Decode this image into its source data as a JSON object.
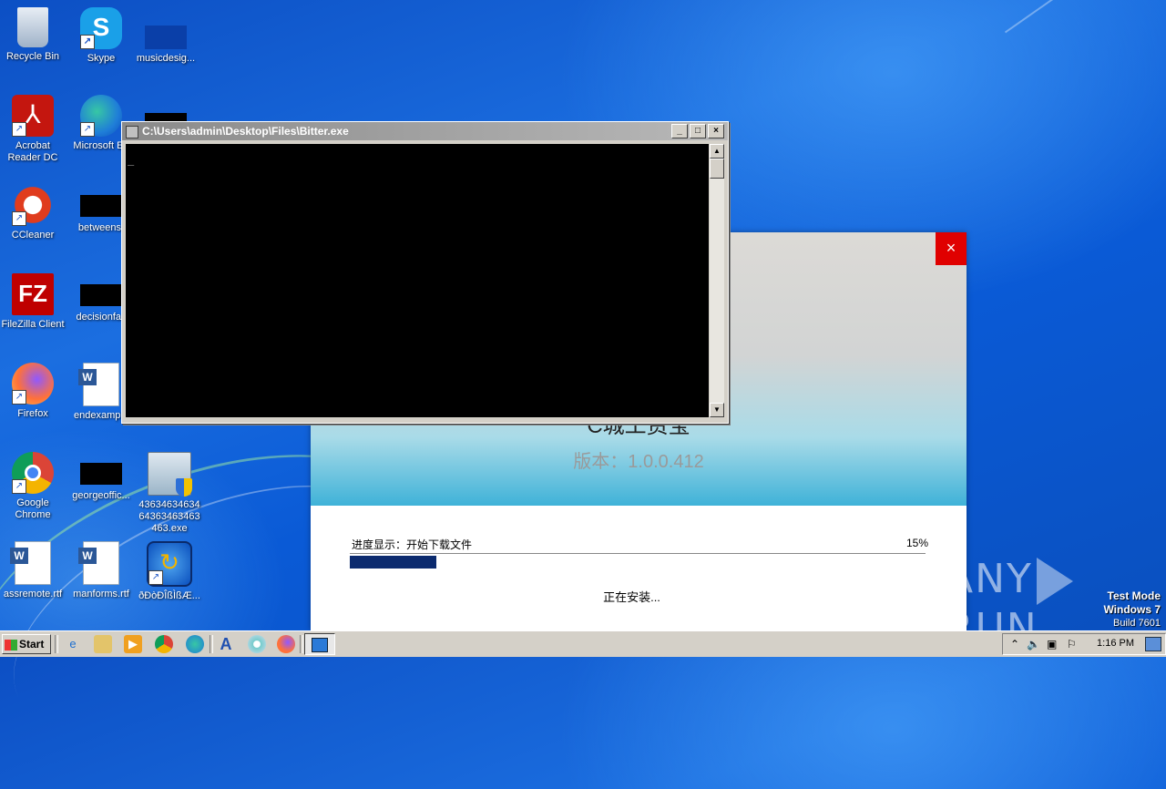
{
  "desktop": {
    "icons": [
      {
        "label": "Recycle Bin",
        "icon": "recycle-bin-icon"
      },
      {
        "label": "Skype",
        "icon": "skype-icon"
      },
      {
        "label": "musicdesig...",
        "icon": "file-icon"
      },
      {
        "label": "Acrobat Reader DC",
        "icon": "acrobat-icon"
      },
      {
        "label": "Microsoft Ed",
        "icon": "edge-icon"
      },
      {
        "label": "CCleaner",
        "icon": "ccleaner-icon"
      },
      {
        "label": "betweenst",
        "icon": "file-icon"
      },
      {
        "label": "FileZilla Client",
        "icon": "filezilla-icon"
      },
      {
        "label": "decisionfav",
        "icon": "file-icon"
      },
      {
        "label": "Firefox",
        "icon": "firefox-icon"
      },
      {
        "label": "endexample",
        "icon": "word-doc-icon"
      },
      {
        "label": "Google Chrome",
        "icon": "chrome-icon"
      },
      {
        "label": "georgeoffic...",
        "icon": "file-icon"
      },
      {
        "label": "43634634634 64363463463 463.exe",
        "icon": "installer-icon"
      },
      {
        "label": "assremote.rtf",
        "icon": "word-doc-icon"
      },
      {
        "label": "manforms.rtf",
        "icon": "word-doc-icon"
      },
      {
        "label": "ðÐòÐÎßÌßÆ...",
        "icon": "setup-icon"
      }
    ]
  },
  "console": {
    "title": "C:\\Users\\admin\\Desktop\\Files\\Bitter.exe",
    "cursor": "_",
    "buttons": {
      "minimize": "_",
      "maximize": "□",
      "close": "×"
    },
    "scroll_up": "▲",
    "scroll_down": "▼"
  },
  "installer": {
    "close": "×",
    "app_name": "C城工资宝",
    "version": "版本：1.0.0.412",
    "progress_label": "进度显示：开始下载文件",
    "progress_percent": "15%",
    "progress_value": 0.15,
    "status": "正在安装..."
  },
  "watermark": {
    "text_left": "ANY",
    "text_right": "RUN"
  },
  "test_mode": {
    "line1": "Test Mode",
    "line2": "Windows 7",
    "line3": "Build 7601"
  },
  "taskbar": {
    "start_label": "Start",
    "clock": "1:16 PM",
    "quick_launch": [
      "internet-explorer-icon",
      "explorer-icon",
      "media-player-icon",
      "chrome-icon",
      "edge-icon",
      "font-icon",
      "cd-icon",
      "firefox-icon"
    ]
  }
}
